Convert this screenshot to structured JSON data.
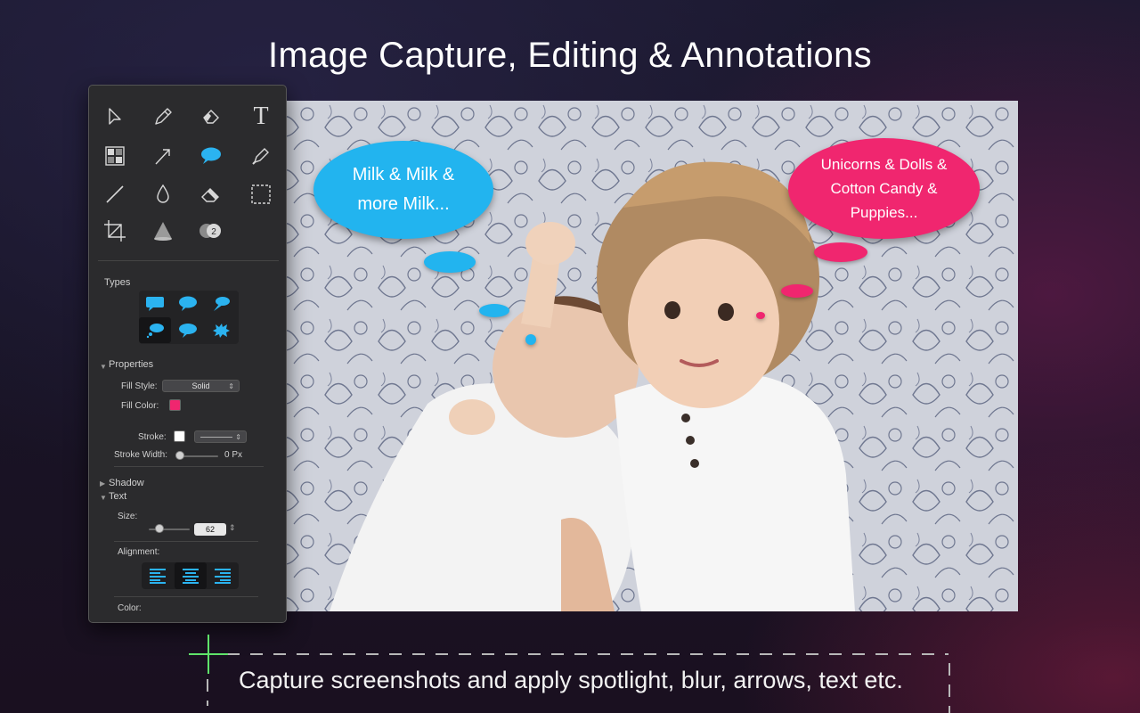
{
  "headline": "Image Capture, Editing & Annotations",
  "caption": "Capture screenshots and apply spotlight, blur, arrows, text etc.",
  "bubbles": {
    "blue": {
      "line1": "Milk & Milk &",
      "line2": "more Milk...",
      "color": "#22b4ef"
    },
    "pink": {
      "line1": "Unicorns & Dolls &",
      "line2": "Cotton Candy &",
      "line3": "Puppies...",
      "color": "#f0266f"
    }
  },
  "tools": [
    "pointer-icon",
    "pencil-icon",
    "highlighter-icon",
    "text-tool-icon",
    "pixelate-icon",
    "arrow-icon",
    "speech-bubble-icon",
    "marker-icon",
    "line-icon",
    "blur-drop-icon",
    "eraser-icon",
    "selection-icon",
    "crop-icon",
    "spotlight-icon",
    "counter-icon"
  ],
  "panel": {
    "types_label": "Types",
    "properties_label": "Properties",
    "fill_style_label": "Fill Style:",
    "fill_style_value": "Solid",
    "fill_color_label": "Fill Color:",
    "fill_color": "#f0266f",
    "stroke_label": "Stroke:",
    "stroke_color": "#ffffff",
    "stroke_width_label": "Stroke Width:",
    "stroke_width_value": "0 Px",
    "shadow_label": "Shadow",
    "text_label": "Text",
    "size_label": "Size:",
    "size_value": "62",
    "alignment_label": "Alignment:",
    "color_label": "Color:",
    "accent_color": "#2bb3f0"
  }
}
